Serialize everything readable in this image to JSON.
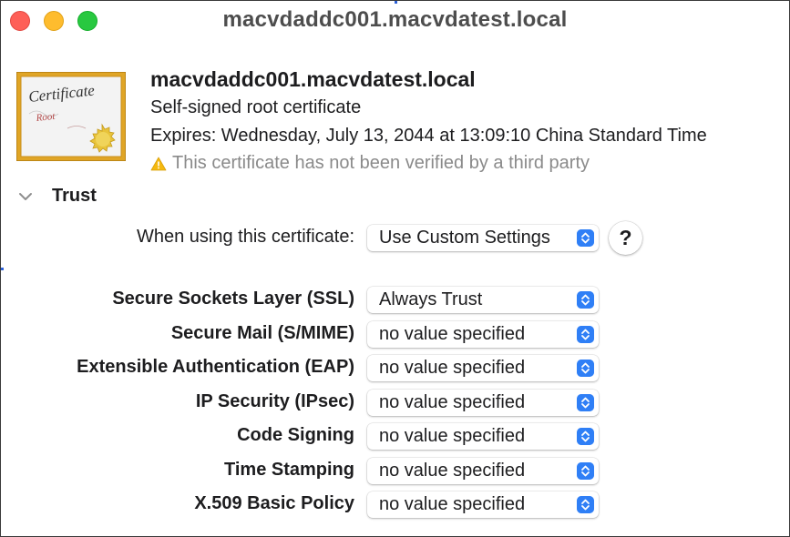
{
  "window": {
    "title": "macvdaddc001.macvdatest.local"
  },
  "certificate": {
    "icon": "certificate-root-icon",
    "icon_text_main": "Certificate",
    "icon_text_sub": "Root",
    "name": "macvdaddc001.macvdatest.local",
    "type": "Self-signed root certificate",
    "expires": "Expires: Wednesday, July 13, 2044 at 13:09:10 China Standard Time",
    "warning": "This certificate has not been verified by a third party"
  },
  "trust": {
    "section_label": "Trust",
    "expanded": true,
    "when_using": {
      "label": "When using this certificate:",
      "value": "Use Custom Settings"
    },
    "help_label": "?",
    "policies": [
      {
        "label": "Secure Sockets Layer (SSL)",
        "value": "Always Trust"
      },
      {
        "label": "Secure Mail (S/MIME)",
        "value": "no value specified"
      },
      {
        "label": "Extensible Authentication (EAP)",
        "value": "no value specified"
      },
      {
        "label": "IP Security (IPsec)",
        "value": "no value specified"
      },
      {
        "label": "Code Signing",
        "value": "no value specified"
      },
      {
        "label": "Time Stamping",
        "value": "no value specified"
      },
      {
        "label": "X.509 Basic Policy",
        "value": "no value specified"
      }
    ]
  },
  "colors": {
    "accent": "#2f7ff6",
    "close": "#fe5f57",
    "minimize": "#febc2e",
    "zoom": "#28c840",
    "warning": "#f5b90f"
  }
}
